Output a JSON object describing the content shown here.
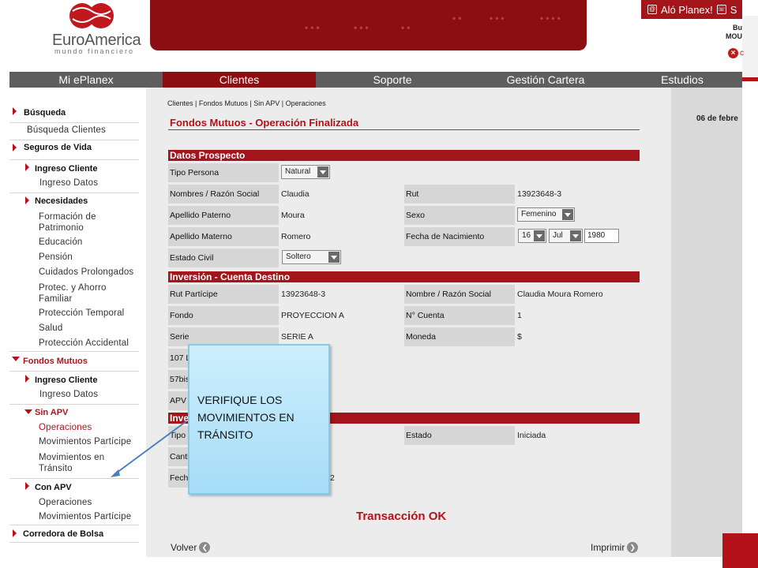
{
  "brand": {
    "name": "EuroAmerica",
    "tagline": "mundo financiero"
  },
  "header": {
    "alo_label": "Aló Planex!",
    "alo_extra": "S",
    "greeting_line1": "Bu",
    "greeting_line2": "MOU",
    "logout_partial": "c"
  },
  "nav": {
    "tabs": [
      {
        "label": "Mi ePlanex",
        "active": false
      },
      {
        "label": "Clientes",
        "active": true
      },
      {
        "label": "Soporte",
        "active": false
      },
      {
        "label": "Gestión Cartera",
        "active": false
      },
      {
        "label": "Estudios",
        "active": false
      }
    ]
  },
  "sidebar": {
    "busqueda": "Búsqueda",
    "busqueda_clientes": "Búsqueda Clientes",
    "seguros_vida": "Seguros de Vida",
    "ingreso_cliente_1": "Ingreso Cliente",
    "ingreso_datos_1": "Ingreso Datos",
    "necesidades": "Necesidades",
    "formacion": "Formación de Patrimonio",
    "educacion": "Educación",
    "pension": "Pensión",
    "cuidados": "Cuidados Prolongados",
    "protec_ahorro": "Protec. y Ahorro Familiar",
    "proteccion_temporal": "Protección Temporal",
    "salud": "Salud",
    "proteccion_accidental": "Protección Accidental",
    "fondos_mutuos": "Fondos Mutuos",
    "ingreso_cliente_2": "Ingreso Cliente",
    "ingreso_datos_2": "Ingreso Datos",
    "sin_apv": "Sin APV",
    "operaciones_1": "Operaciones",
    "mov_participe_1": "Movimientos Partícipe",
    "mov_transito": "Movimientos en Tránsito",
    "con_apv": "Con APV",
    "operaciones_2": "Operaciones",
    "mov_participe_2": "Movimientos Partícipe",
    "corredora": "Corredora de Bolsa"
  },
  "main": {
    "breadcrumb": "Clientes | Fondos Mutuos | Sin APV | Operaciones",
    "title": "Fondos Mutuos - Operación Finalizada",
    "date_partial": "06 de febre",
    "sections": {
      "prospecto": "Datos Prospecto",
      "inversion": "Inversión - Cuenta Destino",
      "inv_partial": "Inver"
    },
    "prospecto": {
      "tipo_persona_label": "Tipo Persona",
      "tipo_persona_value": "Natural",
      "nombres_label": "Nombres / Razón Social",
      "nombres_value": "Claudia",
      "rut_label": "Rut",
      "rut_value": "13923648-3",
      "apellido_paterno_label": "Apellido Paterno",
      "apellido_paterno_value": "Moura",
      "sexo_label": "Sexo",
      "sexo_value": "Femenino",
      "apellido_materno_label": "Apellido Materno",
      "apellido_materno_value": "Romero",
      "fecha_nac_label": "Fecha de Nacimiento",
      "fecha_dia": "16",
      "fecha_mes": "Jul",
      "fecha_anio": "1980",
      "estado_civil_label": "Estado Civil",
      "estado_civil_value": "Soltero"
    },
    "inversion": {
      "rut_participe_label": "Rut Partícipe",
      "rut_participe_value": "13923648-3",
      "nombre_label": "Nombre / Razón Social",
      "nombre_value": "Claudia Moura Romero",
      "fondo_label": "Fondo",
      "fondo_value": "PROYECCION A",
      "cuenta_label": "N° Cuenta",
      "cuenta_value": "1",
      "serie_label": "Serie",
      "serie_value": "SERIE A",
      "moneda_label": "Moneda",
      "moneda_value": "$",
      "row_107": "107 L",
      "row_57": "57bis",
      "row_apv": "APV"
    },
    "operacion": {
      "tipo_label": "Tipo",
      "estado_label": "Estado",
      "estado_value": "Iniciada",
      "cantidad_label": "Canti",
      "fecha_label": "Fech",
      "fecha_value_partial": "2"
    },
    "transaction_ok": "Transacción OK",
    "volver": "Volver",
    "imprimir": "Imprimir"
  },
  "callout": {
    "text": "VERIFIQUE LOS MOVIMIENTOS EN TRÁNSITO"
  },
  "colors": {
    "brand_red": "#8c0e12",
    "section_red": "#a3151a",
    "nav_gray": "#5e5e5e"
  }
}
